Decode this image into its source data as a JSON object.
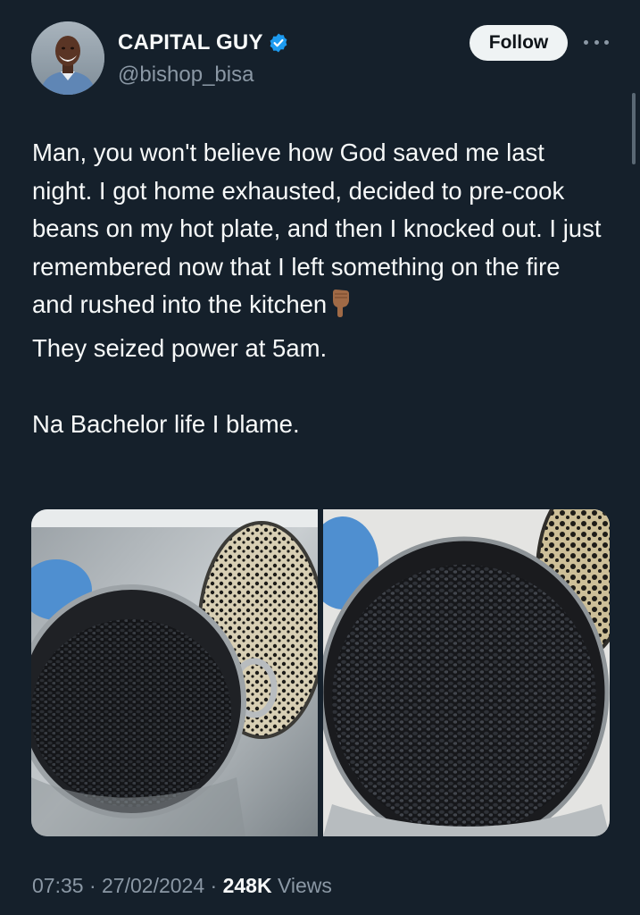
{
  "user": {
    "display_name": "CAPITAL GUY",
    "handle": "@bishop_bisa",
    "verified": true
  },
  "actions": {
    "follow_label": "Follow",
    "more_icon": "more-horizontal-icon"
  },
  "tweet": {
    "paragraph_1": "Man, you won't believe how God saved me last night. I got home exhausted, decided to pre-cook beans on my hot plate, and then I knocked out. I just remembered now that I left something on the fire and rushed into the kitchen",
    "emoji": "👇🏽",
    "paragraph_2": "They seized power at 5am.",
    "paragraph_3": "Na Bachelor life I blame."
  },
  "meta": {
    "time": "07:35",
    "sep_1": " · ",
    "date": "27/02/2024",
    "sep_2": " · ",
    "views_count": "248K",
    "views_label": " Views"
  },
  "colors": {
    "background": "#15202b",
    "text": "#f7f9f9",
    "secondary": "#8b98a5",
    "verified": "#1d9bf0"
  }
}
